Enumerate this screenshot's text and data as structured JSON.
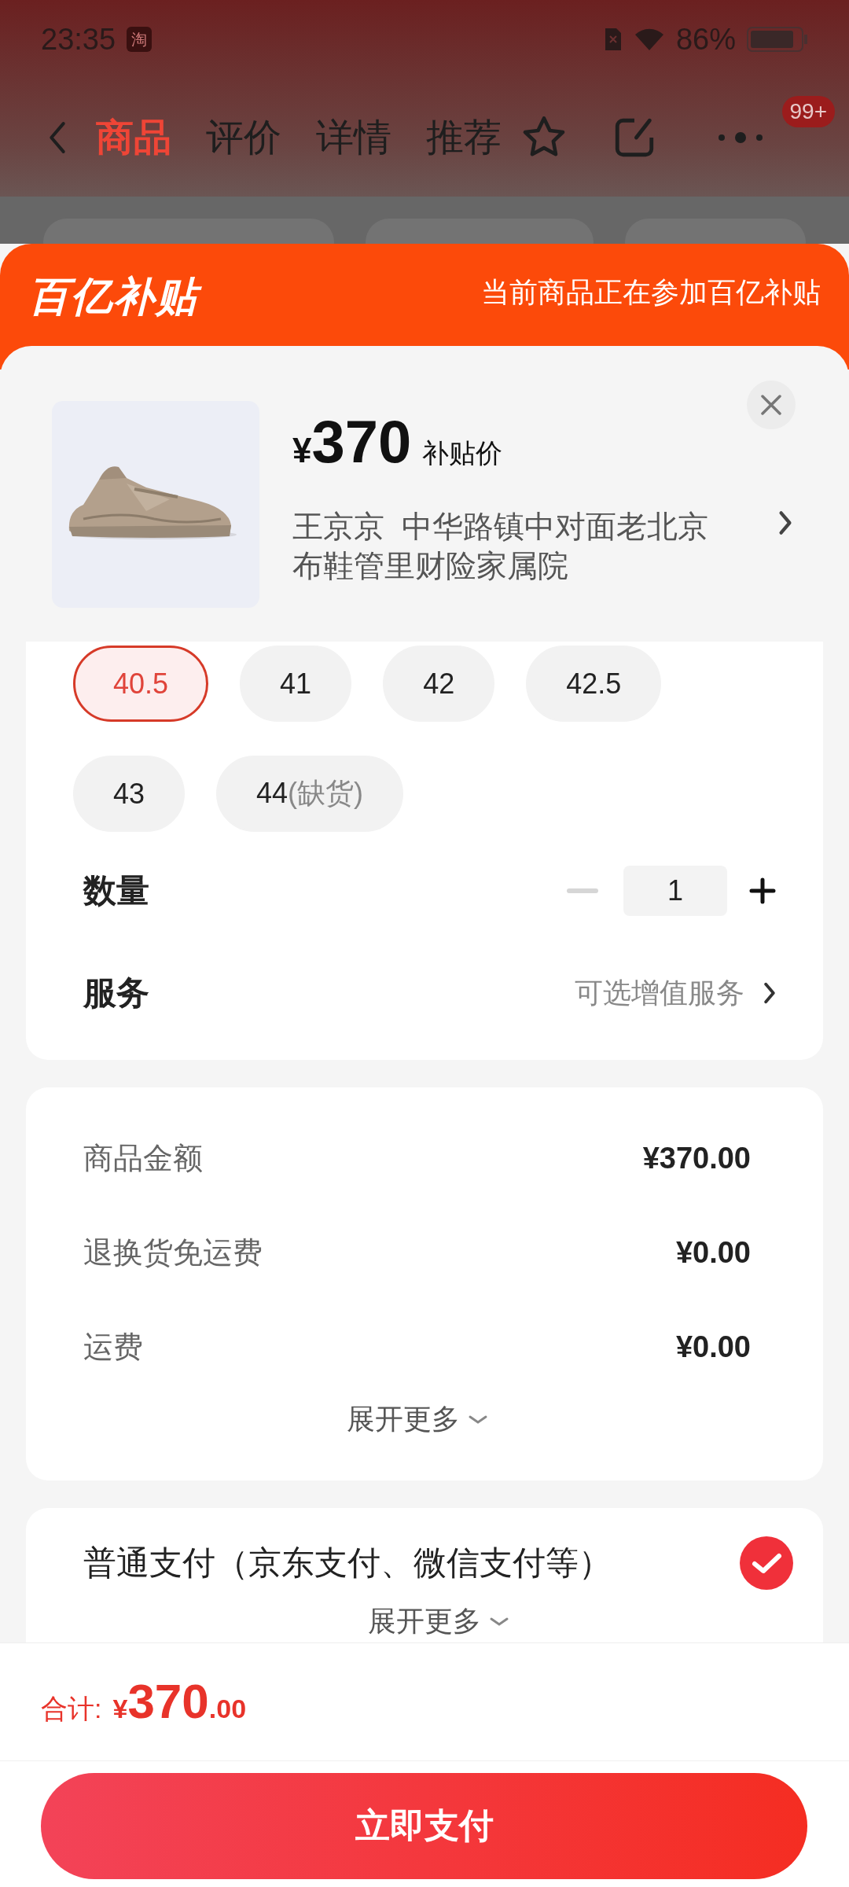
{
  "status_bar": {
    "time": "23:35",
    "app_badge": "淘",
    "battery": "86%"
  },
  "nav": {
    "tabs": [
      {
        "label": "商品",
        "selected": true
      },
      {
        "label": "评价",
        "selected": false
      },
      {
        "label": "详情",
        "selected": false
      },
      {
        "label": "推荐",
        "selected": false
      }
    ],
    "badge": "99+"
  },
  "subsidy_banner": {
    "logo": "百亿补贴",
    "notice": "当前商品正在参加百亿补贴"
  },
  "product": {
    "currency": "¥",
    "price": "370",
    "price_label": "补贴价",
    "address": "王京京  中华路镇中对面老北京布鞋管里财险家属院"
  },
  "sizes": [
    {
      "label": "40.5",
      "selected": true
    },
    {
      "label": "41",
      "selected": false
    },
    {
      "label": "42",
      "selected": false
    },
    {
      "label": "42.5",
      "selected": false
    },
    {
      "label": "43",
      "selected": false
    },
    {
      "label": "44",
      "note": "(缺货)",
      "selected": false
    }
  ],
  "quantity": {
    "label": "数量",
    "value": "1"
  },
  "service": {
    "label": "服务",
    "value": "可选增值服务"
  },
  "costs": {
    "rows": [
      {
        "label": "商品金额",
        "value": "¥370.00"
      },
      {
        "label": "退换货免运费",
        "value": "¥0.00"
      },
      {
        "label": "运费",
        "value": "¥0.00"
      }
    ],
    "expand": "展开更多"
  },
  "payment": {
    "options": [
      {
        "label": "普通支付（京东支付、微信支付等）",
        "selected": true
      }
    ],
    "expand": "展开更多"
  },
  "footer": {
    "total_label": "合计:",
    "currency": "¥",
    "total_integer": "370",
    "total_decimal": ".00",
    "pay_button": "立即支付"
  }
}
